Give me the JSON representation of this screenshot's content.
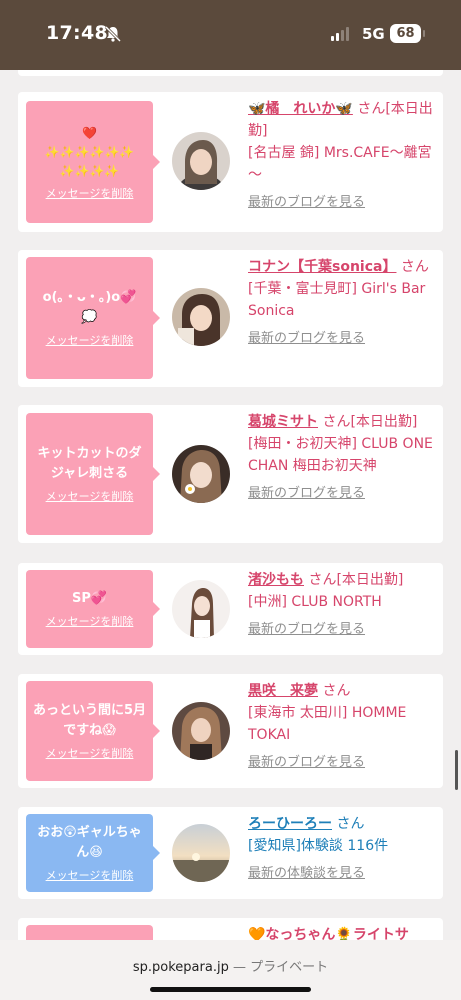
{
  "status": {
    "time": "17:48",
    "network": "5G",
    "battery": "68"
  },
  "cards": [
    {
      "message": "❤️\n✨✨✨✨✨✨\n✨✨✨✨",
      "delete": "メッセージを削除",
      "name": "🦋橘　れいか🦋",
      "san": "さん",
      "status": "[本日出勤]",
      "location": "[名古屋 錦] Mrs.CAFE～離宮～",
      "blog": "最新のブログを見る"
    },
    {
      "message": "o(｡・ᴗ・｡)o💞\n💭",
      "delete": "メッセージを削除",
      "name": "コナン【千葉sonica】",
      "san": "さん",
      "status": "",
      "location": "[千葉・富士見町] Girl's Bar Sonica",
      "blog": "最新のブログを見る"
    },
    {
      "message": "キットカットのダジャレ刺さる",
      "delete": "メッセージを削除",
      "name": "葛城ミサト",
      "san": "さん",
      "status": "[本日出勤]",
      "location": "[梅田・お初天神] CLUB ONE CHAN 梅田お初天神",
      "blog": "最新のブログを見る"
    },
    {
      "message": "SP💞",
      "delete": "メッセージを削除",
      "name": "渚沙もも",
      "san": "さん",
      "status": "[本日出勤]",
      "location": "[中洲] CLUB NORTH",
      "blog": "最新のブログを見る"
    },
    {
      "message": "あっという間に5月ですね😱",
      "delete": "メッセージを削除",
      "name": "黒咲　来夢",
      "san": "さん",
      "status": "",
      "location": "[東海市 太田川] HOMME TOKAI",
      "blog": "最新のブログを見る"
    },
    {
      "message": "おお😲ギャルちゃん😆",
      "delete": "メッセージを削除",
      "name": "ろーひーろー",
      "san": "さん",
      "status": "",
      "location": "[愛知県]体験談 116件",
      "blog": "最新の体験談を見る"
    },
    {
      "message": "",
      "delete": "",
      "name": "🧡なっちゃん🌻ライトサ",
      "san": "",
      "status": "",
      "location": "",
      "blog": ""
    }
  ],
  "browser": {
    "url": "sp.pokepara.jp",
    "separator": " — ",
    "mode": "プライベート"
  }
}
